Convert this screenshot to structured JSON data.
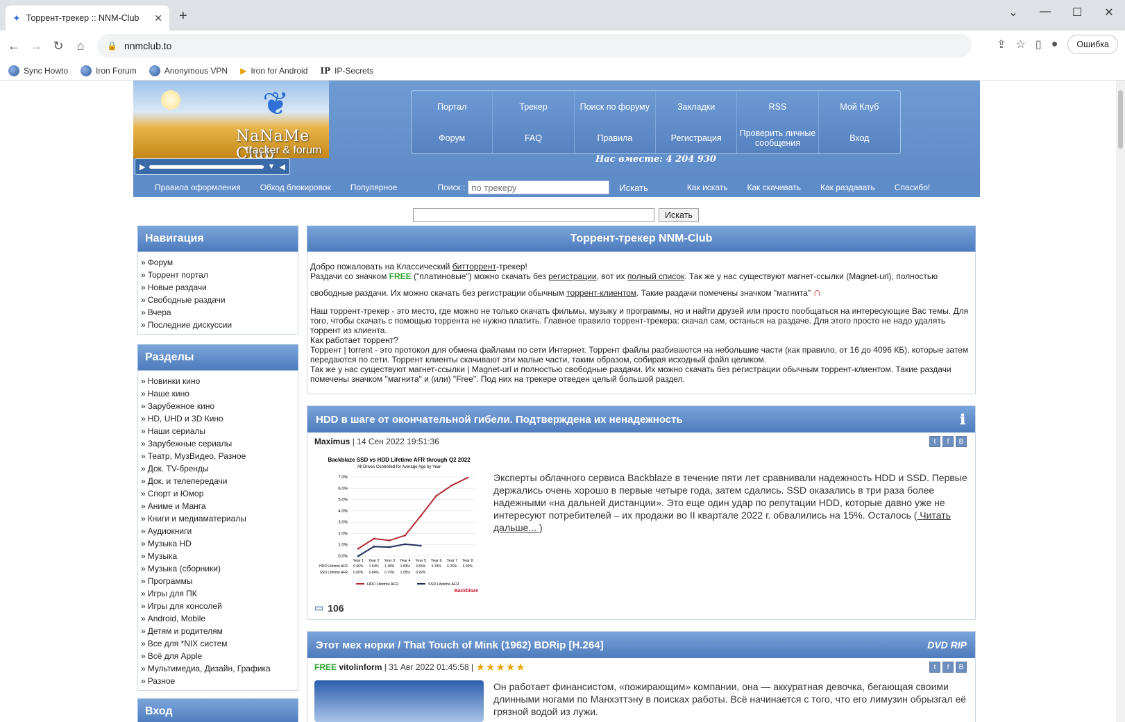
{
  "browser": {
    "tab_title": "Торрент-трекер :: NNM-Club",
    "url": "nnmclub.to",
    "error_button": "Ошибка",
    "bookmarks": [
      "Sync Howto",
      "Iron Forum",
      "Anonymous VPN",
      "Iron for Android",
      "IP-Secrets"
    ]
  },
  "header": {
    "brand": "NaNaMe Club",
    "brand_sub": "tracker & forum",
    "nav": [
      "Портал",
      "Трекер",
      "Поиск по форуму",
      "Закладки",
      "RSS",
      "Мой Клуб",
      "Форум",
      "FAQ",
      "Правила",
      "Регистрация",
      "Проверить личные сообщения",
      "Вход"
    ],
    "together": "Нас вместе: 4 204 930",
    "subnav": {
      "left": [
        "Правила оформления",
        "Обход блокировок",
        "Популярное"
      ],
      "search_label": "Поиск :",
      "search_placeholder": "по трекеру",
      "search_button": "Искать",
      "right": [
        "Как искать",
        "Как скачивать",
        "Как раздавать",
        "Спасибо!"
      ]
    }
  },
  "main_search": {
    "button": "Искать"
  },
  "sidebar": {
    "nav_title": "Навигация",
    "nav_items": [
      "Форум",
      "Торрент портал",
      "Новые раздачи",
      "Свободные раздачи",
      "Вчера",
      "Последние дискуссии"
    ],
    "sections_title": "Разделы",
    "section_items": [
      "Новинки кино",
      "Наше кино",
      "Зарубежное кино",
      "HD, UHD и 3D Кино",
      "Наши сериалы",
      "Зарубежные сериалы",
      "Театр, МузВидео, Разное",
      "Док. TV-бренды",
      "Док. и телепередачи",
      "Спорт и Юмор",
      "Аниме и Манга",
      "Книги и медиаматериалы",
      "Аудиокниги",
      "Музыка HD",
      "Музыка",
      "Музыка (сборники)",
      "Программы",
      "Игры для ПК",
      "Игры для консолей",
      "Android, Mobile",
      "Детям и родителям",
      "Все для *NIX систем",
      "Всё для Apple",
      "Мультимедиа, Дизайн, Графика",
      "Разное"
    ],
    "login_title": "Вход"
  },
  "welcome": {
    "title": "Торрент-трекер NNM-Club",
    "l1a": "Добро пожаловать на Классический ",
    "l1b": "биттоppент",
    "l1c": "-трекер!",
    "l2a": "Раздачи со значком ",
    "l2free": "FREE",
    "l2b": " (\"платиновые\") можно скачать без ",
    "l2c": "регистрации",
    "l2d": ", вот их ",
    "l2e": "полный список",
    "l2f": ". Так же у нас существуют магнет-ссылки (Magnet-url), полностью",
    "l3a": "свободные раздачи. Их можно скачать без регистрации обычным ",
    "l3b": "торрент-клиентом",
    "l3c": ". Такие раздачи помечены значком \"магнита\"",
    "p2": "Наш торрент-трекер - это место, где можно не только скачать фильмы, музыку и программы, но и найти друзей или просто пообщаться на интересующие Вас темы. Для того, чтобы скачать с помощью торрента не нужно платить. Главное правило торрент-трекера: скачал сам, останься на раздаче. Для этого просто не надо удалять торрент из клиента.",
    "p3": "Как работает торрент?",
    "p4": "Торрент | torrent - это протокол для обмена файлами по сети Интернет. Торрент файлы разбиваются на небольшие части (как правило, от 16 до 4096 КБ), которые затем передаются по сети. Торрент клиенты скачивают эти малые части, таким образом, собирая исходный файл целиком.",
    "p5": "Так же у нас существуют магнет-ссылки | Magnet-url и полностью свободные раздачи. Их можно скачать без регистрации обычным торрент-клиентом. Такие раздачи помечены значком \"магнита\" и (или) \"Free\". Под них на трекере отведен целый большой раздел."
  },
  "news1": {
    "title": "HDD в шаге от окончательной гибели. Подтверждена их ненадежность",
    "author": "Maximus",
    "date": "| 14 Сен 2022 19:51:36",
    "text": "Эксперты облачного сервиса Backblaze в течение пяти лет сравнивали надежность HDD и SSD. Первые держались очень хорошо в первые четыре года, затем сдались. SSD оказались в три раза более надежными «на дальней дистанции». Это еще один удар по репутации HDD, которые давно уже не интересуют потребителей – их продажи во II квартале 2022 г. обвалились на 15%. Осталось (",
    "more": " Читать дальше... ",
    "close": ")",
    "comments": "106"
  },
  "news2": {
    "title": "Этот мех норки / That Touch of Mink (1962) BDRip [H.264]",
    "free": "FREE",
    "author": "vitolinform",
    "date": "| 31 Авг 2022 01:45:58 |",
    "stars": "★★★★★",
    "badge": "DVD RIP",
    "text": "Он работает финансистом, «пожирающим» компании, она — аккуратная девочка, бегающая своими длинными ногами по Манхэттэну в поисках работы. Всё начинается с того, что его лимузин обрызгал её грязной водой из лужи."
  },
  "chart_data": {
    "type": "line",
    "title": "Backblaze SSD vs HDD Lifetime AFR through Q2 2022",
    "subtitle": "All Drives Controlled for Average Age by Year",
    "categories": [
      "Year 1",
      "Year 2",
      "Year 3",
      "Year 4",
      "Year 5",
      "Year 6",
      "Year 7",
      "Year 8"
    ],
    "ylim": [
      0,
      7
    ],
    "yticks": [
      "7.0%",
      "6.0%",
      "5.0%",
      "4.0%",
      "3.0%",
      "2.0%",
      "1.0%",
      "0.0%"
    ],
    "series": [
      {
        "name": "HDD Lifetime AFR",
        "color": "#b22a35",
        "values": [
          0.66,
          1.54,
          1.38,
          1.83,
          3.55,
          5.33,
          6.26,
          6.93
        ],
        "labels": [
          "0.66%",
          "1.54%",
          "1.38%",
          "1.83%",
          "3.55%",
          "5.33%",
          "6.26%",
          "6.93%"
        ]
      },
      {
        "name": "SSD Lifetime AFR",
        "color": "#1f2d5a",
        "values": [
          0.0,
          0.84,
          0.79,
          1.05,
          0.92
        ],
        "labels": [
          "0.00%",
          "0.84%",
          "0.79%",
          "1.05%",
          "0.92%"
        ]
      }
    ],
    "brand": "Backblaze"
  }
}
